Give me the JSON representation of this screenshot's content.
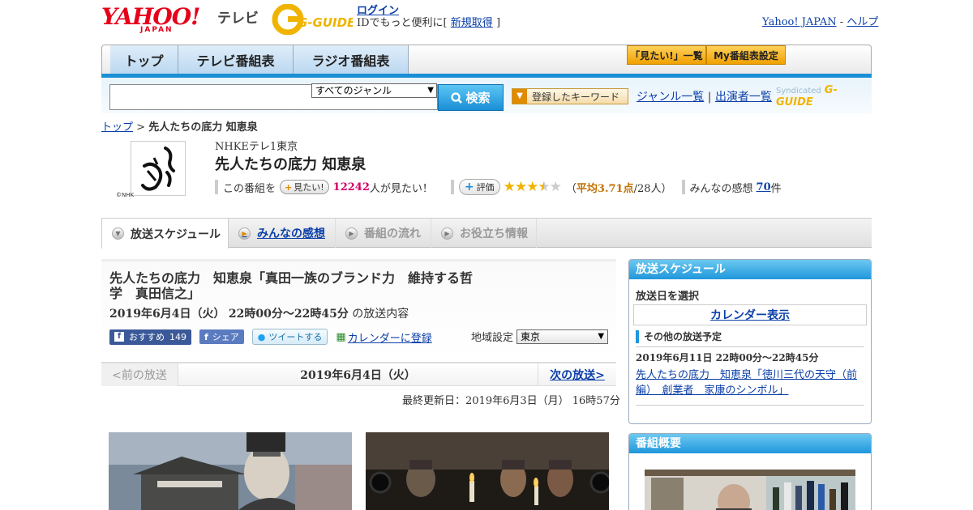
{
  "header": {
    "yahoo_logo": "YAHOO!",
    "yahoo_sub": "JAPAN",
    "tv_label": "テレビ",
    "gguide_logo": "G-GUIDE",
    "login_link": "ログイン",
    "login_tagline_pre": "IDでもっと便利に[",
    "register_link": "新規取得",
    "login_tagline_post": "]",
    "yahoo_japan_link": "Yahoo! JAPAN",
    "help_sep": "-",
    "help_link": "ヘルプ"
  },
  "nav": {
    "tabs": [
      "トップ",
      "テレビ番組表",
      "ラジオ番組表"
    ],
    "want_list_btn": "「見たい!」一覧",
    "my_schedule_btn": "My番組表設定"
  },
  "search": {
    "input_value": "",
    "genre_selected": "すべてのジャンル",
    "search_btn": "検索",
    "keyword_btn": "登録したキーワード",
    "genre_list_link": "ジャンル一覧",
    "links_sep": "|",
    "cast_list_link": "出演者一覧",
    "syndicated_label": "Syndicated",
    "syndicated_logo": "G-GUIDE"
  },
  "breadcrumb": {
    "home": "トップ",
    "sep": ">",
    "current": "先人たちの底力 知恵泉"
  },
  "program": {
    "channel": "NHKEテレ1東京",
    "title": "先人たちの底力 知恵泉",
    "logo_credit": "©NHK",
    "want_label_pre": "この番組を",
    "want_btn": "見たい!",
    "want_count": "12242",
    "want_label_post": "人が見たい！",
    "rate_btn": "評価",
    "rating_avg_text": "平均3.71点",
    "rating_count_text": "/28人）",
    "rating_open": "（",
    "rating_value": 3.71,
    "reviews_label": "みんなの感想",
    "reviews_count": "70",
    "reviews_unit": "件"
  },
  "subtabs": [
    {
      "label": "放送スケジュール",
      "state": "active"
    },
    {
      "label": "みんなの感想",
      "state": "link"
    },
    {
      "label": "番組の流れ",
      "state": "disabled"
    },
    {
      "label": "お役立ち情報",
      "state": "disabled"
    }
  ],
  "episode": {
    "title": "先人たちの底力　知恵泉「真田一族のブランド力　維持する哲学　真田信之」",
    "date": "2019年6月4日（火）",
    "time": "22時00分～22時45分",
    "date_suffix": "の放送内容",
    "fb_like_label": "おすすめ",
    "fb_like_count": "149",
    "fb_share": "シェア",
    "tweet": "ツイートする",
    "calendar_register": "カレンダーに登録",
    "region_label": "地域設定",
    "region_selected": "東京",
    "prev_broadcast": "<前の放送",
    "pager_date": "2019年6月4日（火）",
    "next_broadcast": "次の放送>",
    "updated": "最終更新日：2019年6月3日（月） 16時57分"
  },
  "sidebar": {
    "schedule_head": "放送スケジュール",
    "select_date_label": "放送日を選択",
    "calendar_btn": "カレンダー表示",
    "other_head": "その他の放送予定",
    "other_date": "2019年6月11日",
    "other_time": "22時00分～22時45分",
    "other_title": "先人たちの底力　知恵泉「徳川三代の天守（前編）　創業者　家康のシンボル」",
    "overview_head": "番組概要"
  },
  "colors": {
    "accent_blue": "#1a8fd6",
    "yahoo_red": "#e6001a",
    "want_pink": "#d40067",
    "star_gold": "#f0b400"
  }
}
